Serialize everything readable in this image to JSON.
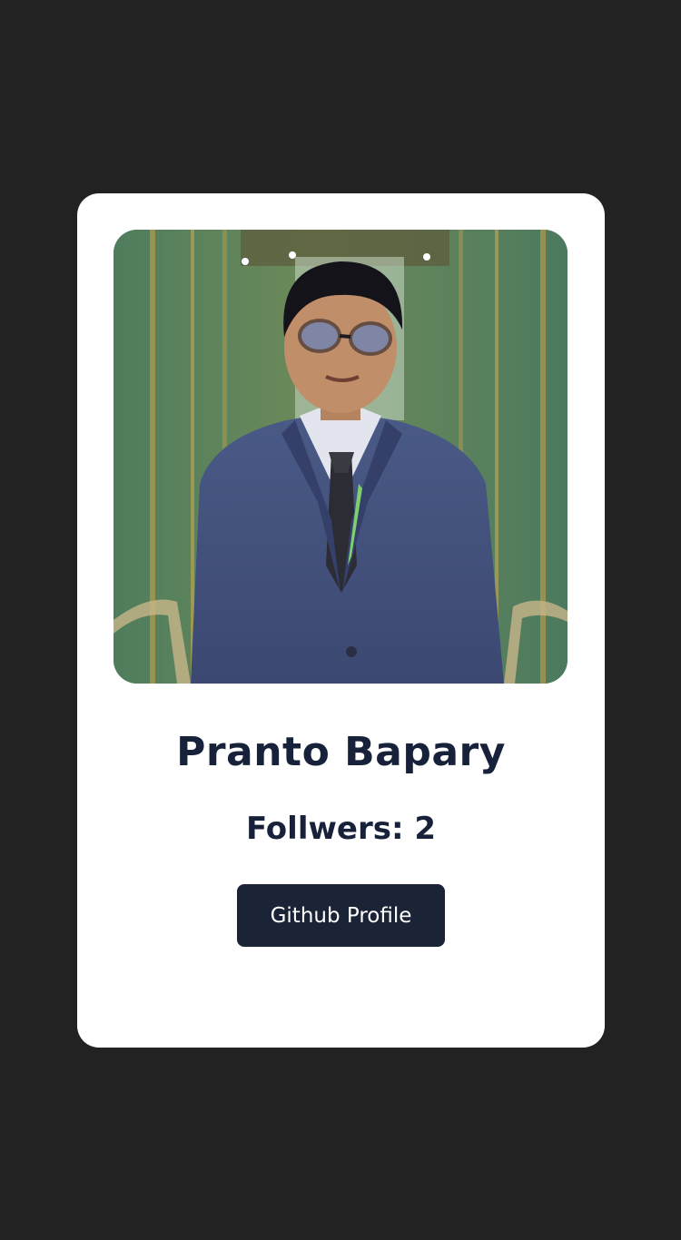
{
  "profile": {
    "name": "Pranto Bapary",
    "followers_text": "Follwers: 2",
    "button_label": "Github Profile",
    "photo_icon": "avatar-photo"
  },
  "colors": {
    "page_bg": "#222222",
    "card_bg": "#ffffff",
    "text": "#17213a",
    "button_bg": "#1b2336",
    "button_text": "#ffffff"
  }
}
